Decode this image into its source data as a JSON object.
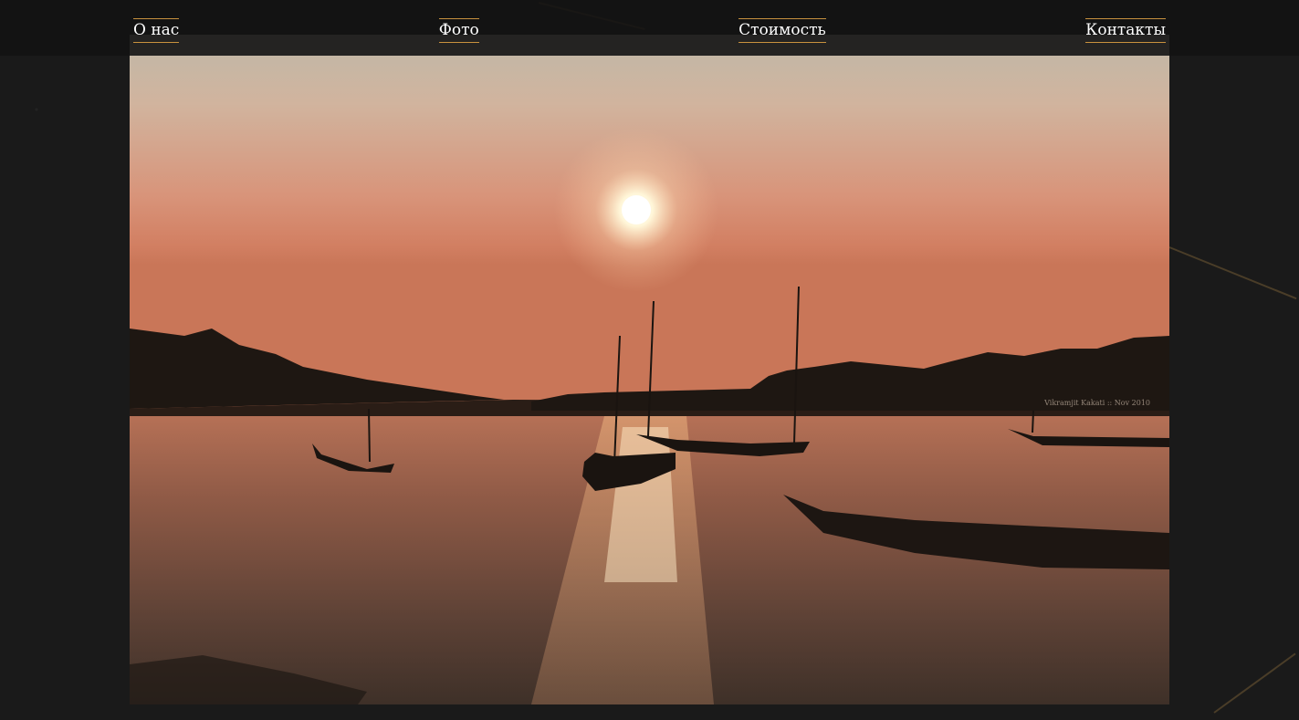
{
  "nav": {
    "items": [
      "О нас",
      "Фото",
      "Стоимость",
      "Контакты"
    ]
  },
  "photo": {
    "watermark": "Vikramjit Kakati :: Nov 2010"
  },
  "colors": {
    "accent": "#c8913e",
    "background": "#191919",
    "navbar": "#121212"
  }
}
